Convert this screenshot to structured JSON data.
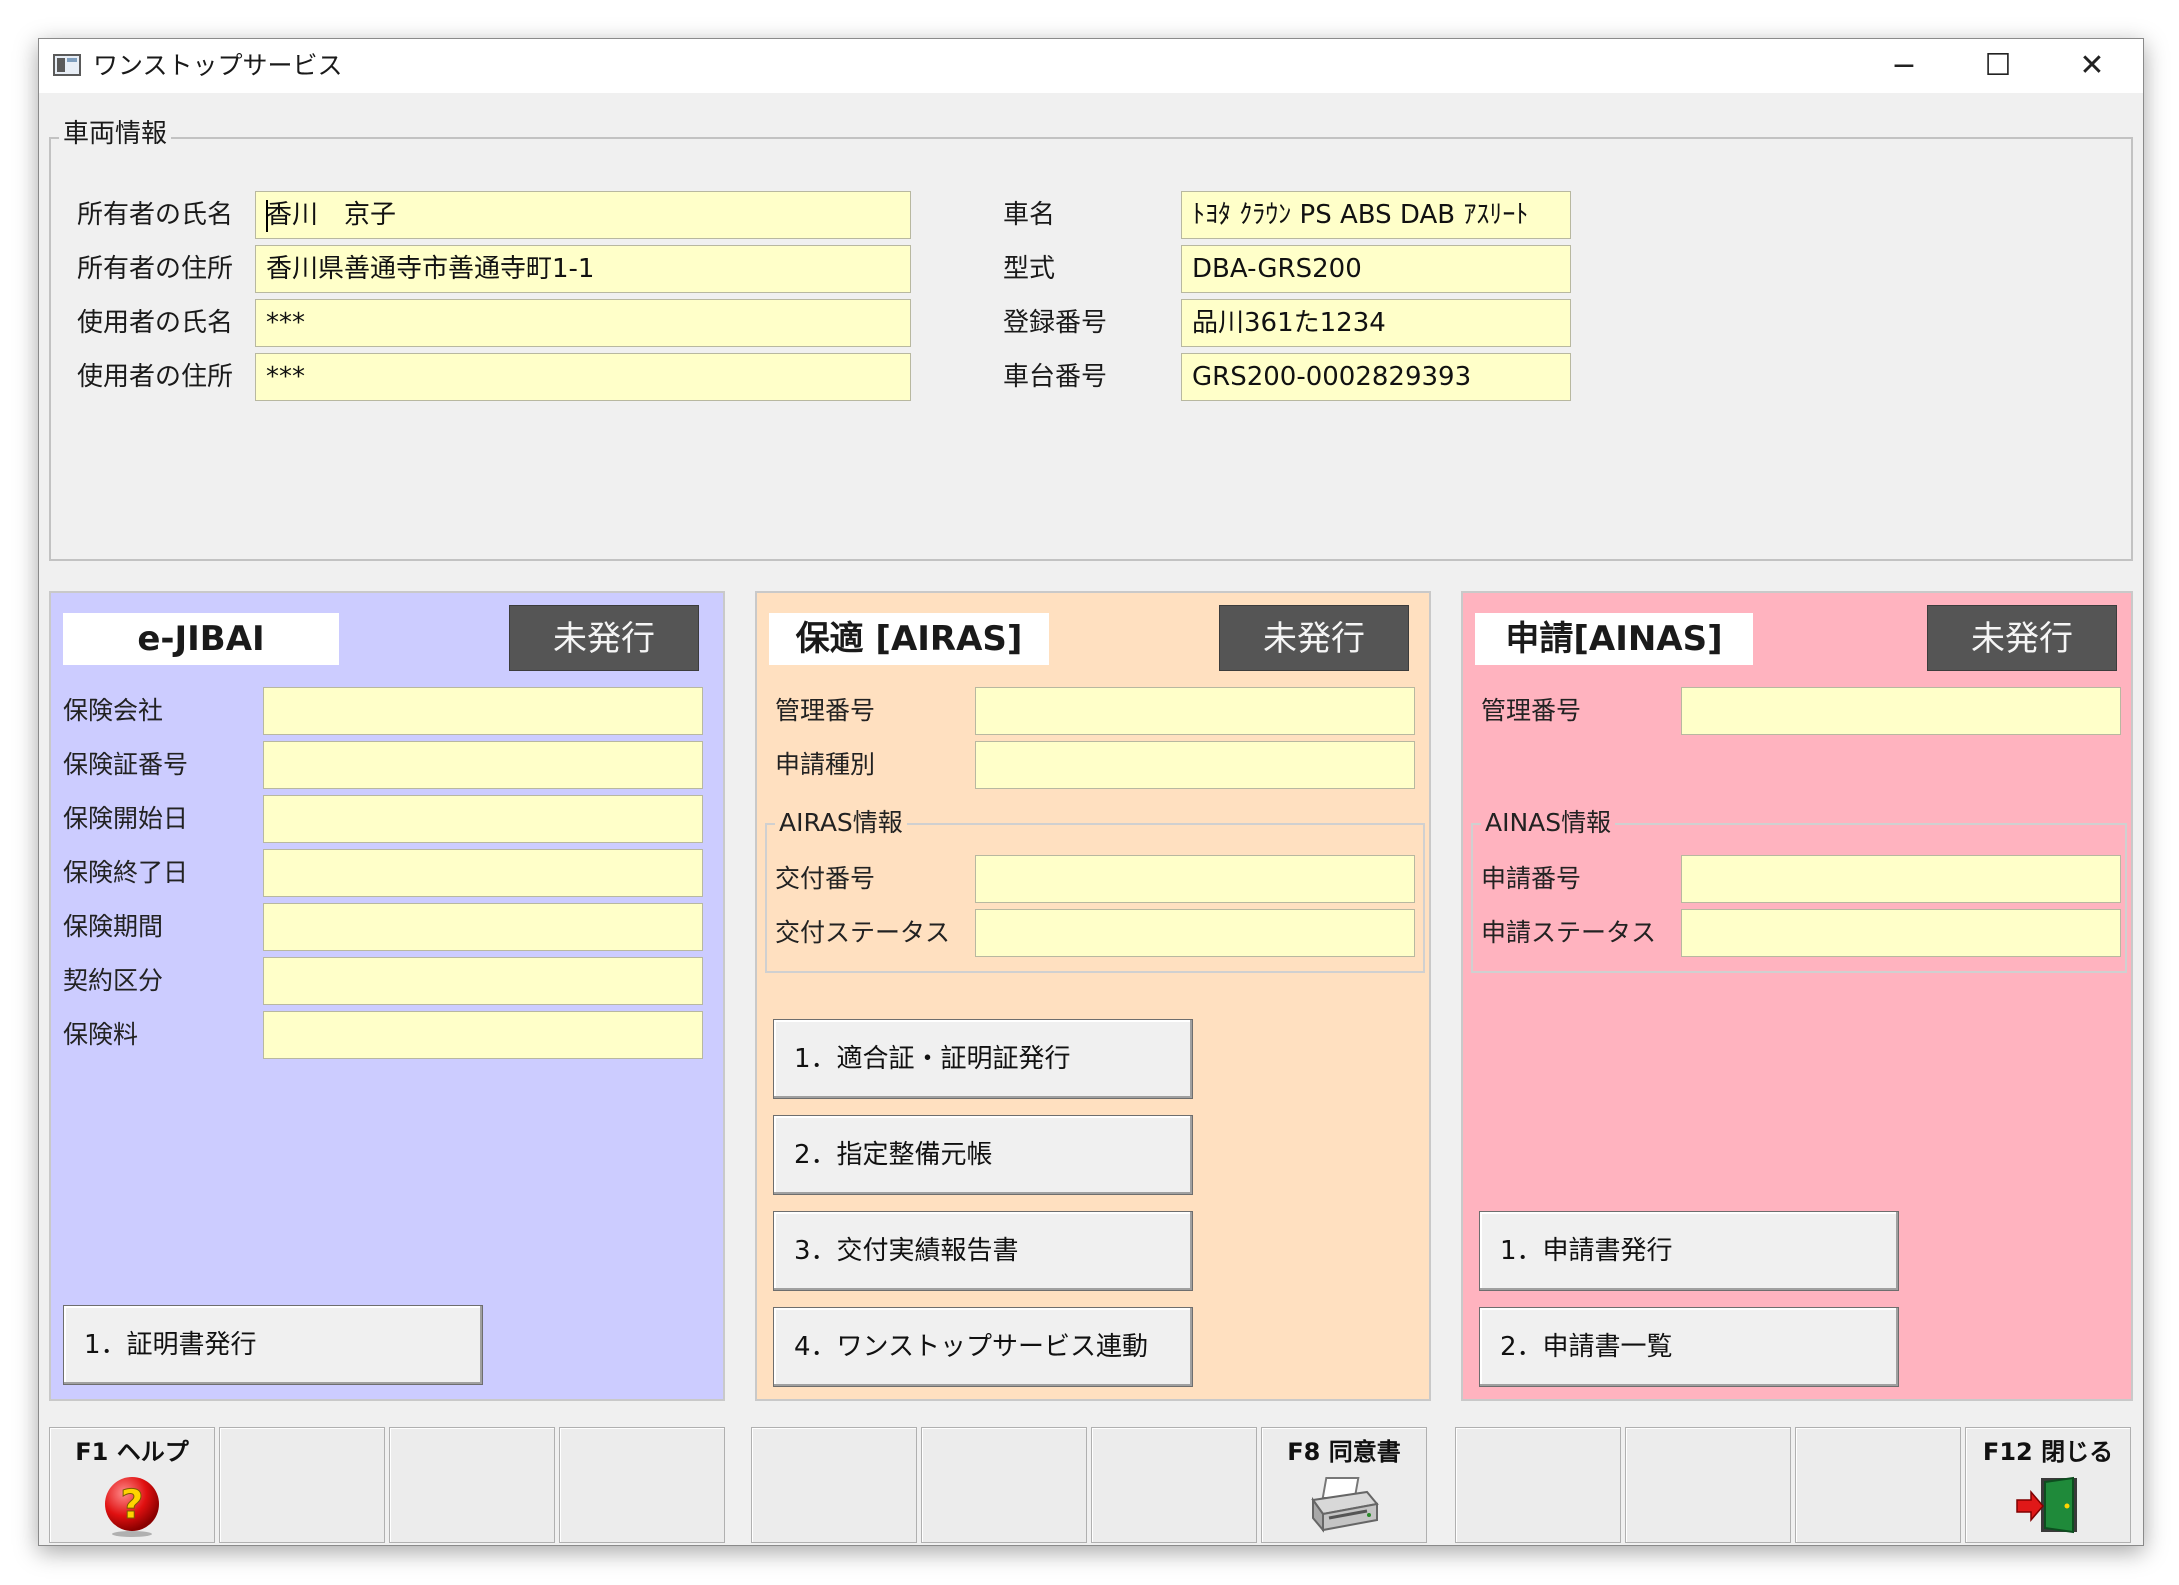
{
  "window": {
    "title": "ワンストップサービス",
    "minimize": "−",
    "maximize": "☐",
    "close": "✕"
  },
  "vehicle_info": {
    "legend": "車両情報",
    "left_fields": [
      {
        "label": "所有者の氏名",
        "value": "香川　京子"
      },
      {
        "label": "所有者の住所",
        "value": "香川県善通寺市善通寺町1-1"
      },
      {
        "label": "使用者の氏名",
        "value": "***"
      },
      {
        "label": "使用者の住所",
        "value": "***"
      }
    ],
    "right_fields": [
      {
        "label": "車名",
        "value": "ﾄﾖﾀ ｸﾗｳﾝ PS ABS DAB ｱｽﾘｰﾄ"
      },
      {
        "label": "型式",
        "value": "DBA-GRS200"
      },
      {
        "label": "登録番号",
        "value": "品川361た1234"
      },
      {
        "label": "車台番号",
        "value": "GRS200-0002829393"
      }
    ]
  },
  "panels": {
    "ejibai": {
      "title": "e-JIBAI",
      "status": "未発行",
      "color": "#ccccff",
      "fields": [
        "保険会社",
        "保険証番号",
        "保険開始日",
        "保険終了日",
        "保険期間",
        "契約区分",
        "保険料"
      ],
      "buttons": [
        "1．証明書発行"
      ]
    },
    "airas": {
      "title": "保適 [AIRAS]",
      "status": "未発行",
      "color": "#ffe0c0",
      "fields": [
        "管理番号",
        "申請種別"
      ],
      "group_legend": "AIRAS情報",
      "group_fields": [
        "交付番号",
        "交付ステータス"
      ],
      "buttons": [
        "1．適合証・証明証発行",
        "2．指定整備元帳",
        "3．交付実績報告書",
        "4．ワンストップサービス連動"
      ]
    },
    "ainas": {
      "title": "申請[AINAS]",
      "status": "未発行",
      "color": "#ffb3bf",
      "fields": [
        "管理番号"
      ],
      "group_legend": "AINAS情報",
      "group_fields": [
        "申請番号",
        "申請ステータス"
      ],
      "buttons": [
        "1．申請書発行",
        "2．申請書一覧"
      ]
    }
  },
  "function_keys": {
    "f1": {
      "label": "F1 ヘルプ",
      "icon": "help-icon"
    },
    "f8": {
      "label": "F8 同意書",
      "icon": "printer-icon"
    },
    "f12": {
      "label": "F12 閉じる",
      "icon": "exit-door-icon"
    }
  }
}
